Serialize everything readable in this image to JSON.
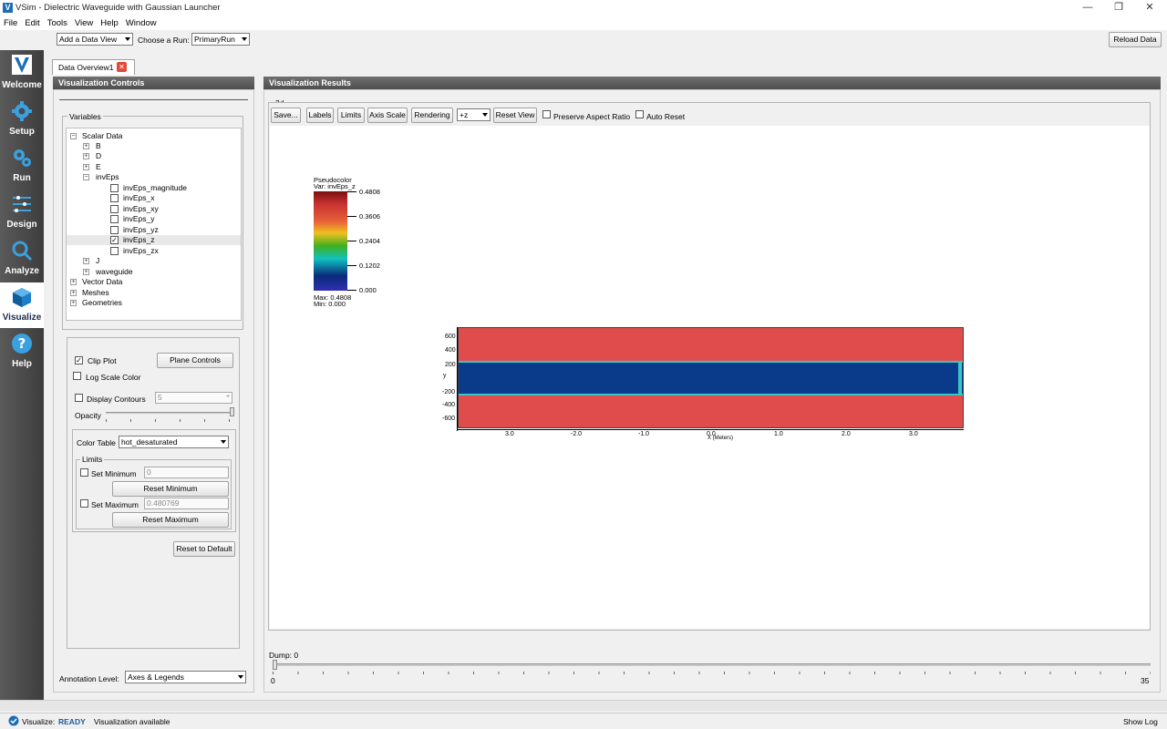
{
  "window": {
    "title": "VSim - Dielectric Waveguide with Gaussian Launcher",
    "icon": "vsim-app-icon",
    "minimize_glyph": "—",
    "maximize_glyph": "❐",
    "close_glyph": "✕"
  },
  "menu": [
    "File",
    "Edit",
    "Tools",
    "View",
    "Help",
    "Window"
  ],
  "toolbar": {
    "add_view": "Add a Data View",
    "choose_run_label": "Choose a Run:",
    "run_value": "PrimaryRun",
    "reload": "Reload Data"
  },
  "nav": [
    {
      "label": "Welcome",
      "icon": "vsim-logo-icon"
    },
    {
      "label": "Setup",
      "icon": "gear-icon"
    },
    {
      "label": "Run",
      "icon": "gears-icon"
    },
    {
      "label": "Design",
      "icon": "design-lines-icon"
    },
    {
      "label": "Analyze",
      "icon": "magnifier-icon"
    },
    {
      "label": "Visualize",
      "icon": "cube-icon"
    },
    {
      "label": "Help",
      "icon": "question-icon"
    }
  ],
  "tab": {
    "label": "Data Overview1",
    "close_glyph": "✕"
  },
  "controls": {
    "header": "Visualization Controls",
    "variables_label": "Variables",
    "tree": [
      {
        "label": "Scalar Data",
        "exp": "−"
      },
      {
        "label": "B",
        "exp": "+"
      },
      {
        "label": "D",
        "exp": "+"
      },
      {
        "label": "E",
        "exp": "+"
      },
      {
        "label": "invEps",
        "exp": "−"
      },
      {
        "label": "invEps_magnitude",
        "checked": false
      },
      {
        "label": "invEps_x",
        "checked": false
      },
      {
        "label": "invEps_xy",
        "checked": false
      },
      {
        "label": "invEps_y",
        "checked": false
      },
      {
        "label": "invEps_yz",
        "checked": false
      },
      {
        "label": "invEps_z",
        "checked": true
      },
      {
        "label": "invEps_zx",
        "checked": false
      },
      {
        "label": "J",
        "exp": "+"
      },
      {
        "label": "waveguide",
        "exp": "+"
      },
      {
        "label": "Vector Data",
        "exp": "+"
      },
      {
        "label": "Meshes",
        "exp": "+"
      },
      {
        "label": "Geometries",
        "exp": "+"
      }
    ],
    "clip_plot": "Clip Plot",
    "plane_controls": "Plane Controls",
    "log_scale": "Log Scale Color",
    "display_contours": "Display Contours",
    "contour_count": "5",
    "opacity": "Opacity",
    "color_table_label": "Color Table",
    "color_table_value": "hot_desaturated",
    "limits_label": "Limits",
    "set_minimum": "Set Minimum",
    "min_value": "0",
    "reset_minimum": "Reset Minimum",
    "set_maximum": "Set Maximum",
    "max_value": "0.480769",
    "reset_maximum": "Reset Maximum",
    "reset_default": "Reset to Default",
    "annotation_label": "Annotation Level:",
    "annotation_value": "Axes & Legends"
  },
  "results": {
    "header": "Visualization Results",
    "view_label": "3d",
    "buttons": [
      "Save...",
      "Labels",
      "Limits",
      "Axis Scale",
      "Rendering"
    ],
    "orient": "+z",
    "reset_view": "Reset View",
    "preserve_aspect": "Preserve Aspect Ratio",
    "auto_reset": "Auto Reset",
    "legend": {
      "title": "Pseudocolor",
      "var": "Var: invEps_z",
      "ticks": [
        "0.4808",
        "0.3606",
        "0.2404",
        "0.1202",
        "0.000"
      ],
      "max": "Max:  0.4808",
      "min": "Min:  0.000"
    },
    "plot": {
      "y_ticks": [
        "600",
        "400",
        "200",
        "-200",
        "-400",
        "-600"
      ],
      "y_label": "y",
      "x_ticks": [
        "3.0",
        "-2.0",
        "-1.0",
        "0.0",
        "1.0",
        "2.0",
        "3.0"
      ],
      "x_label": "X (Meters)",
      "colors": {
        "outer": "#e04b4b",
        "core": "#0a3a8a",
        "edge": "#39c6c6",
        "frame": "#404040"
      }
    },
    "dump_label": "Dump: 0",
    "slider_min": "0",
    "slider_max": "35"
  },
  "status": {
    "label": "Visualize:",
    "state": "READY",
    "message": "Visualization available",
    "show_log": "Show Log"
  }
}
